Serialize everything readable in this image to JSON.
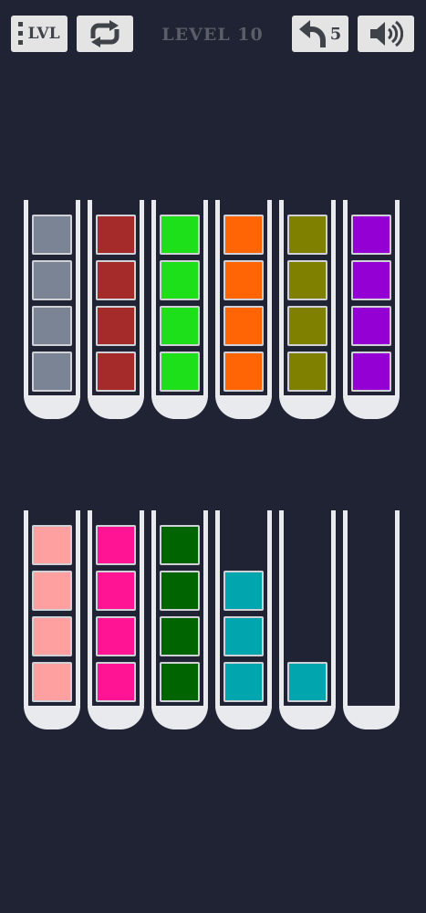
{
  "header": {
    "lvl_label": "LVL",
    "level_title": "LEVEL 10",
    "undo_count": "5",
    "icons": {
      "lvl": "menu-dots-icon",
      "restart": "restart-arrows-icon",
      "undo": "undo-arrow-icon",
      "sound": "speaker-icon"
    }
  },
  "colors": {
    "background": "#1f2333",
    "tube": "#e9eaee",
    "gray": "#7b8495",
    "red": "#a52a2a",
    "green": "#1ee01a",
    "orange": "#ff6405",
    "olive": "#808000",
    "purple": "#9400d3",
    "pink": "#ffa0a0",
    "magenta": "#ff1493",
    "darkgreen": "#006400",
    "teal": "#00a5ad"
  },
  "tubes": [
    {
      "blocks": [
        "gray",
        "gray",
        "gray",
        "gray"
      ]
    },
    {
      "blocks": [
        "red",
        "red",
        "red",
        "red"
      ]
    },
    {
      "blocks": [
        "green",
        "green",
        "green",
        "green"
      ]
    },
    {
      "blocks": [
        "orange",
        "orange",
        "orange",
        "orange"
      ]
    },
    {
      "blocks": [
        "olive",
        "olive",
        "olive",
        "olive"
      ]
    },
    {
      "blocks": [
        "purple",
        "purple",
        "purple",
        "purple"
      ]
    },
    {
      "blocks": [
        "pink",
        "pink",
        "pink",
        "pink"
      ]
    },
    {
      "blocks": [
        "magenta",
        "magenta",
        "magenta",
        "magenta"
      ]
    },
    {
      "blocks": [
        "darkgreen",
        "darkgreen",
        "darkgreen",
        "darkgreen"
      ]
    },
    {
      "blocks": [
        "teal",
        "teal",
        "teal"
      ]
    },
    {
      "blocks": [
        "teal"
      ]
    },
    {
      "blocks": []
    }
  ]
}
